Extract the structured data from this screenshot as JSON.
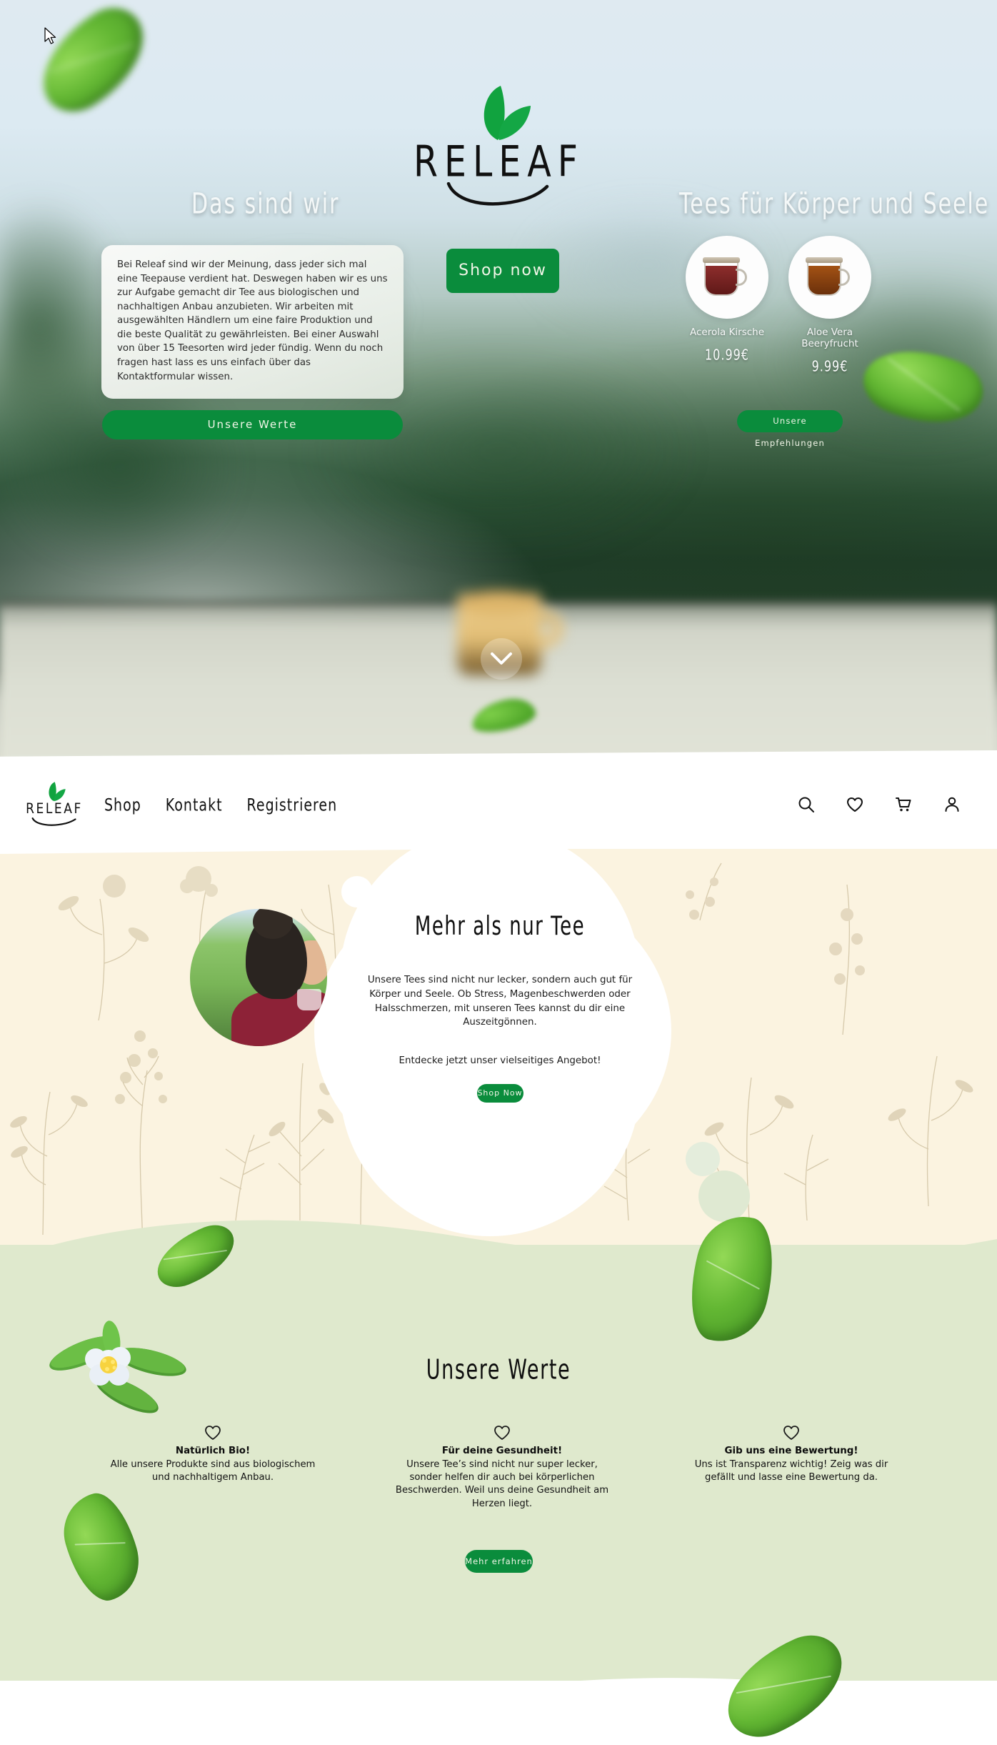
{
  "brand": {
    "name": "RELEAF",
    "logo_icon": "leaf-logo-icon",
    "accent_green": "#0a8c3c"
  },
  "hero": {
    "left_heading": "Das sind wir",
    "right_heading": "Tees für Körper und Seele",
    "shop_now_label": "Shop now",
    "about_text": "Bei Releaf sind wir der Meinung, dass jeder sich mal eine Teepause verdient hat. Deswegen haben wir es uns zur Aufgabe gemacht dir Tee aus biologischen und nachhaltigen Anbau anzubieten. Wir arbeiten mit ausgewählten Händlern um eine faire Produktion und die beste Qualität zu gewährleisten. Bei einer Auswahl von über 15 Teesorten wird jeder fündig.\nWenn du noch fragen hast lass es uns einfach über das Kontaktformular wissen.",
    "values_button_label": "Unsere Werte",
    "recommendations_button_label": "Unsere Empfehlungen",
    "scroll_icon": "chevron-down-icon",
    "products": [
      {
        "name": "Acerola Kirsche",
        "price": "10.99€",
        "image_icon": "tea-cup-red-icon"
      },
      {
        "name": "Aloe Vera Beeryfrucht",
        "price": "9.99€",
        "image_icon": "tea-cup-amber-icon"
      }
    ]
  },
  "nav": {
    "logo_text": "RELEAF",
    "links": [
      {
        "label": "Shop"
      },
      {
        "label": "Kontakt"
      },
      {
        "label": "Registrieren"
      }
    ],
    "icons": [
      {
        "name": "search-icon"
      },
      {
        "name": "heart-icon"
      },
      {
        "name": "cart-icon"
      },
      {
        "name": "account-icon"
      }
    ]
  },
  "more_than_tea": {
    "title": "Mehr als nur Tee",
    "paragraph": "Unsere Tees sind nicht nur lecker, sondern auch gut für Körper und Seele. Ob Stress, Magenbeschwerden oder Halsschmerzen, mit unseren Tees kannst du dir eine Auszeitgönnen.",
    "cta_line": "Entdecke jetzt unser vielseitiges Angebot!",
    "button_label": "Shop Now",
    "image_icon": "woman-drinking-tea-photo"
  },
  "values": {
    "title": "Unsere Werte",
    "button_label": "Mehr erfahren",
    "columns": [
      {
        "icon": "heart-icon",
        "heading": "Natürlich Bio!",
        "text": "Alle unsere Produkte sind aus biologischem und nachhaltigem Anbau."
      },
      {
        "icon": "heart-icon",
        "heading": "Für deine Gesundheit!",
        "text": "Unsere Tee’s sind nicht nur super lecker, sonder helfen dir auch bei körperlichen Beschwerden. Weil uns deine Gesundheit am Herzen liegt."
      },
      {
        "icon": "heart-icon",
        "heading": "Gib uns eine Bewertung!",
        "text": "Uns ist Transparenz wichtig! Zeig was dir gefällt und lasse eine Bewertung da."
      }
    ]
  }
}
